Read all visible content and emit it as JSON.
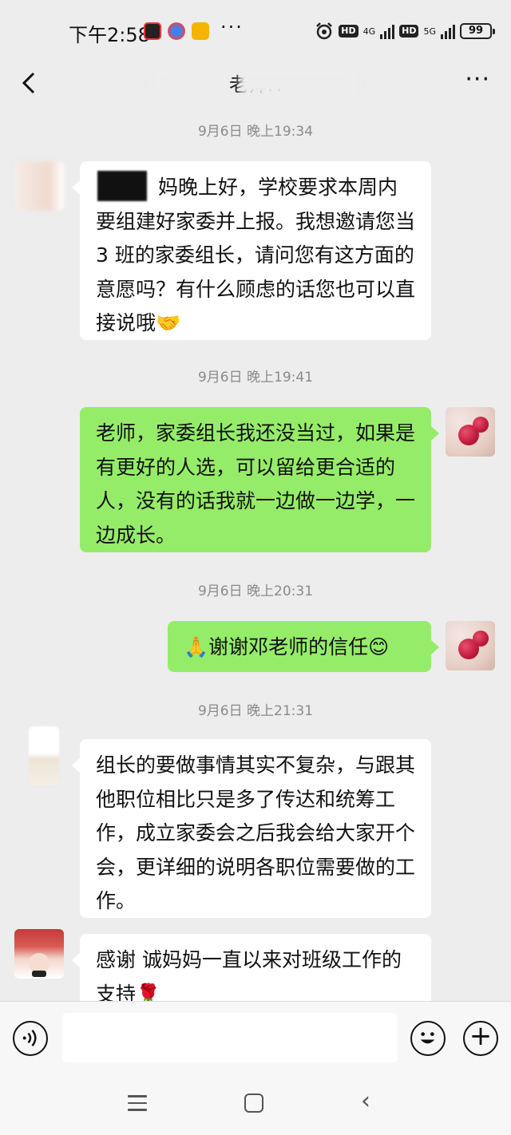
{
  "status_bar": {
    "time": "下午2:58",
    "dots": "···",
    "net1": "4G",
    "net2": "5G",
    "hd": "HD",
    "battery": "99"
  },
  "header": {
    "title": "老师H",
    "back_icon": "chevron-left-icon",
    "more_icon": "more-icon",
    "more_label": "···"
  },
  "messages": [
    {
      "timestamp": "9月6日 晚上19:34",
      "side": "left",
      "text": "妈晚上好，学校要求本周内要组建好家委并上报。我想邀请您当3 班的家委组长，请问您有这方面的意愿吗？有什么顾虑的话您也可以直接说哦🤝"
    },
    {
      "timestamp": "9月6日 晚上19:41",
      "side": "right",
      "text": "老师，家委组长我还没当过，如果是有更好的人选，可以留给更合适的人，没有的话我就一边做一边学，一边成长。"
    },
    {
      "timestamp": "9月6日 晚上20:31",
      "side": "right",
      "text": "🙏谢谢邓老师的信任😊"
    },
    {
      "timestamp": "9月6日 晚上21:31",
      "side": "left",
      "text": "组长的要做事情其实不复杂，与跟其他职位相比只是多了传达和统筹工作，成立家委会之后我会给大家开个会，更详细的说明各职位需要做的工作。"
    },
    {
      "side": "left",
      "text": "感谢 诚妈妈一直以来对班级工作的支持🌹"
    }
  ],
  "input_bar": {
    "voice_icon": "voice-icon",
    "emoji_icon": "emoji-icon",
    "plus_icon": "plus-icon",
    "plus_label": "+"
  },
  "nav_bar": {
    "menu_icon": "menu-icon",
    "home_icon": "home-icon",
    "back_icon": "back-icon",
    "back_label": "‹"
  },
  "colors": {
    "background": "#ededed",
    "bubble_self": "#95ec69",
    "bubble_other": "#ffffff",
    "timestamp": "#8a8a8a"
  }
}
